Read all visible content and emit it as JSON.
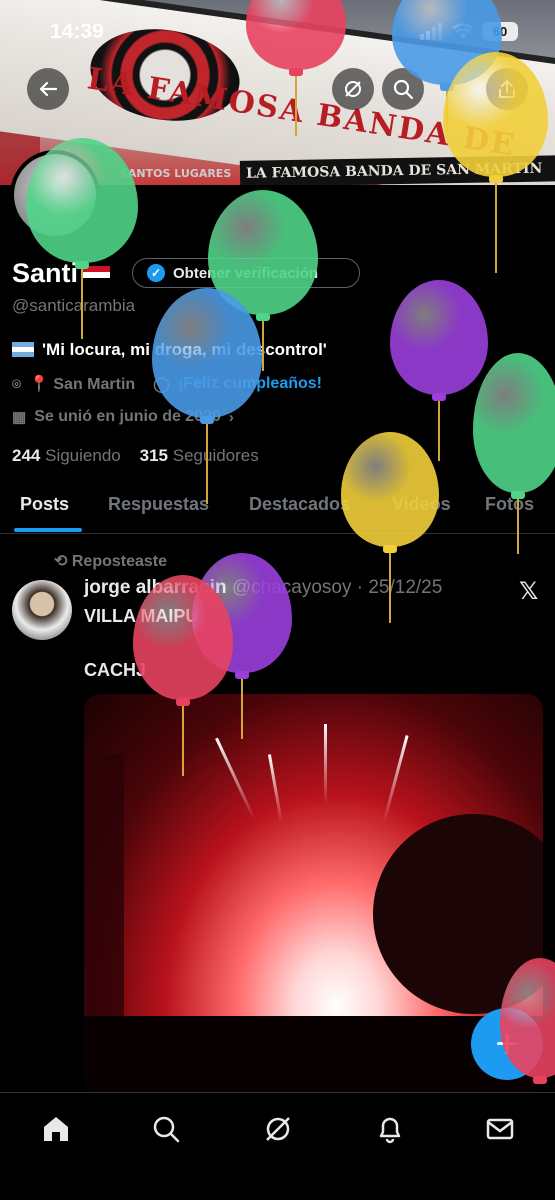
{
  "status_bar": {
    "time": "14:39",
    "battery": "60"
  },
  "banner": {
    "text_main": "LA FAMOSA BANDA DE",
    "text_strip": "LA FAMOSA BANDA DE SAN MARTIN",
    "text_small": "SANTOS LUGARES"
  },
  "profile": {
    "name": "Santi",
    "verify_label": "Obtener verificación",
    "handle": "@santicarambia",
    "bio": "'Mi locura, mi droga, mi descontrol'",
    "location": "📍 San Martin",
    "birthday": "¡Feliz cumpleaños!",
    "joined": "Se unió en junio de 2020",
    "following_count": "244",
    "following_label": "Siguiendo",
    "followers_count": "315",
    "followers_label": "Seguidores"
  },
  "tabs": [
    {
      "label": "Posts"
    },
    {
      "label": "Respuestas"
    },
    {
      "label": "Destacados"
    },
    {
      "label": "Videos"
    },
    {
      "label": "Fotos"
    }
  ],
  "post": {
    "repost_label": "Reposteaste",
    "author": "jorge albarracin",
    "author_handle": "@chacayosoy",
    "date": "· 25/12/25",
    "line1": "VILLA MAIPU",
    "line2": "CACHJ"
  },
  "colors": {
    "accent": "#1d9bf0",
    "muted": "#71767b",
    "background": "#000000"
  },
  "icons": [
    "back-arrow-icon",
    "grok-icon",
    "search-icon",
    "share-icon",
    "location-icon",
    "balloon-icon",
    "calendar-icon",
    "chevron-right-icon",
    "repost-icon",
    "x-logo-icon",
    "plus-icon",
    "home-icon",
    "explore-icon",
    "grok-nav-icon",
    "notifications-icon",
    "messages-icon"
  ]
}
